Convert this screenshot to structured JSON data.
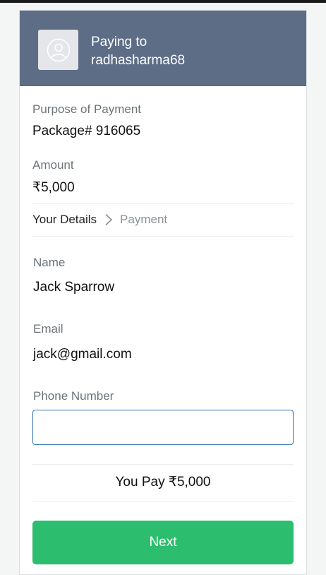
{
  "header": {
    "paying_to_label": "Paying to",
    "payee": "radhasharma68",
    "avatar_icon": "user-avatar-icon",
    "background_color": "#5d6d86"
  },
  "payment": {
    "purpose_label": "Purpose of Payment",
    "purpose_value": "Package# 916065",
    "amount_label": "Amount",
    "amount_value": "₹5,000"
  },
  "steps": {
    "current": "Your Details",
    "next": "Payment",
    "separator_icon": "chevron-right-icon"
  },
  "form": {
    "name_label": "Name",
    "name_value": "Jack Sparrow",
    "email_label": "Email",
    "email_value": "jack@gmail.com",
    "phone_label": "Phone Number",
    "phone_value": "",
    "phone_placeholder": ""
  },
  "summary": {
    "you_pay": "You Pay ₹5,000"
  },
  "actions": {
    "next_label": "Next",
    "next_color": "#2dbd6e"
  }
}
